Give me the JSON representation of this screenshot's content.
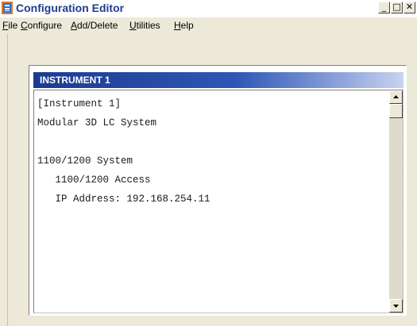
{
  "window": {
    "title": "Configuration Editor",
    "minimize_glyph": "_",
    "maximize_glyph": "□",
    "close_glyph": "✕"
  },
  "menu": [
    {
      "label": "File",
      "underline": "F",
      "rest": "ile"
    },
    {
      "label": "Configure",
      "underline": "C",
      "rest": "onfigure"
    },
    {
      "label": "Add/Delete",
      "underline": "A",
      "rest": "dd/Delete"
    },
    {
      "label": "Utilities",
      "underline": "U",
      "rest": "tilities"
    },
    {
      "label": "Help",
      "underline": "H",
      "rest": "elp"
    }
  ],
  "panel": {
    "header": "INSTRUMENT 1",
    "lines": [
      "[Instrument 1]",
      "Modular 3D LC System",
      "",
      "1100/1200 System",
      "   1100/1200 Access",
      "   IP Address: 192.168.254.11"
    ]
  },
  "colors": {
    "title_text": "#1f3c8f",
    "header_gradient_start": "#1c3a8e",
    "header_gradient_end": "#c7d3ef",
    "window_bg": "#ece9d8"
  },
  "icons": {
    "app": "app-icon",
    "scroll_up": "arrow-up-icon",
    "scroll_down": "arrow-down-icon"
  }
}
